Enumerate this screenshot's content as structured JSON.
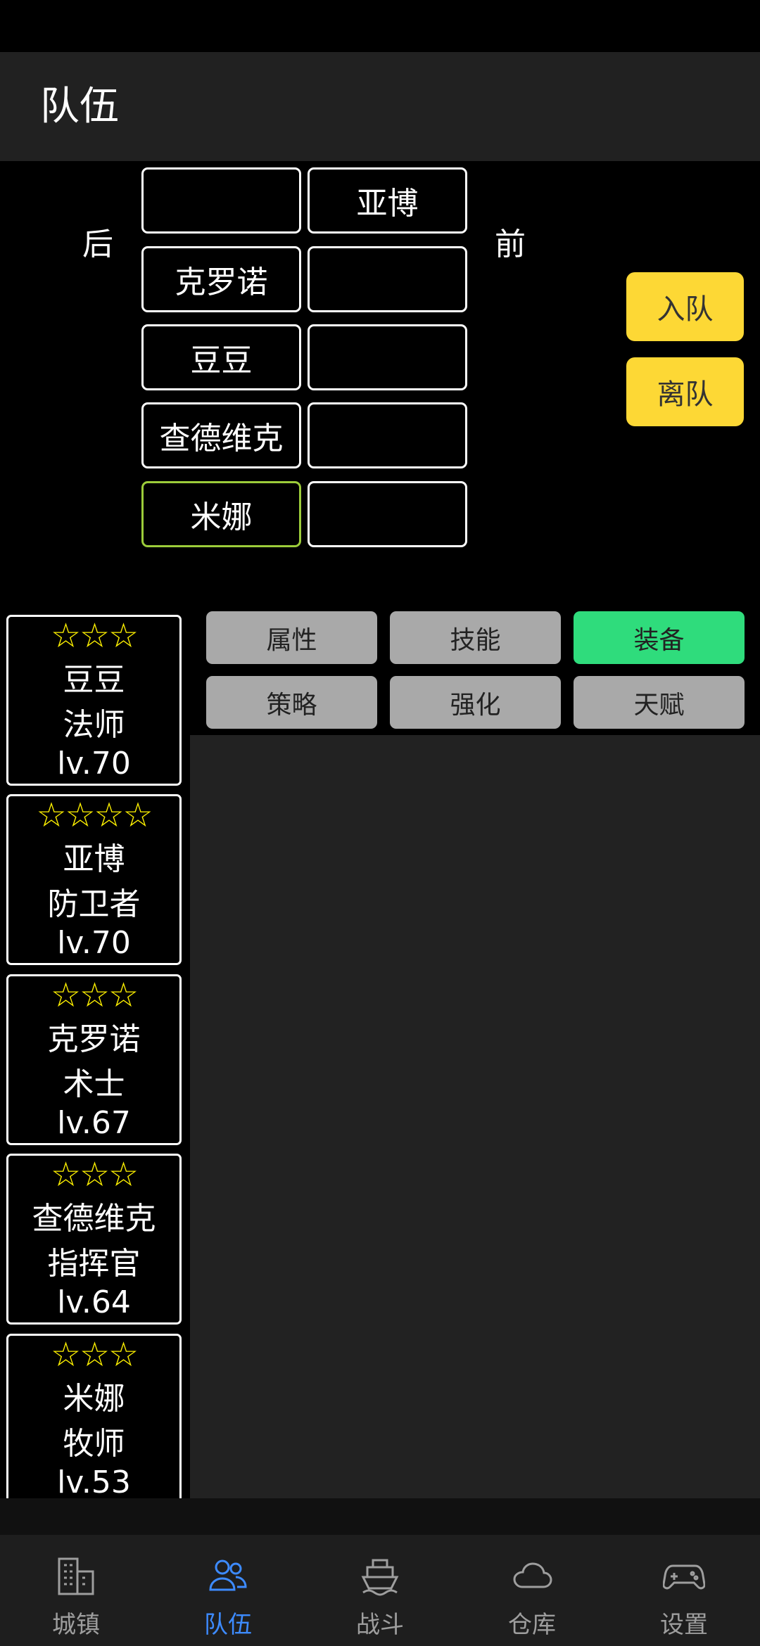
{
  "app": {
    "title": "队伍"
  },
  "formation": {
    "back_label": "后",
    "front_label": "前",
    "rows": [
      {
        "back": "",
        "front": "亚博"
      },
      {
        "back": "克罗诺",
        "front": ""
      },
      {
        "back": "豆豆",
        "front": ""
      },
      {
        "back": "查德维克",
        "front": ""
      },
      {
        "back": "米娜",
        "front": ""
      }
    ],
    "join_button": "入队",
    "leave_button": "离队"
  },
  "roster": [
    {
      "stars": "☆☆☆",
      "name": "豆豆",
      "class": "法师",
      "level": "lv.70"
    },
    {
      "stars": "☆☆☆☆",
      "name": "亚博",
      "class": "防卫者",
      "level": "lv.70"
    },
    {
      "stars": "☆☆☆",
      "name": "克罗诺",
      "class": "术士",
      "level": "lv.67"
    },
    {
      "stars": "☆☆☆",
      "name": "查德维克",
      "class": "指挥官",
      "level": "lv.64"
    },
    {
      "stars": "☆☆☆",
      "name": "米娜",
      "class": "牧师",
      "level": "lv.53"
    }
  ],
  "tabs": [
    {
      "label": "属性"
    },
    {
      "label": "技能"
    },
    {
      "label": "装备",
      "active": true
    },
    {
      "label": "策略"
    },
    {
      "label": "强化"
    },
    {
      "label": "天赋"
    }
  ],
  "nav": [
    {
      "label": "城镇",
      "icon": "building-icon"
    },
    {
      "label": "队伍",
      "icon": "people-icon",
      "active": true
    },
    {
      "label": "战斗",
      "icon": "ship-icon"
    },
    {
      "label": "仓库",
      "icon": "cloud-icon"
    },
    {
      "label": "设置",
      "icon": "gamepad-icon"
    }
  ],
  "colors": {
    "accent_yellow": "#fdd835",
    "active_tab": "#2fdc7c",
    "nav_active": "#3d8bff",
    "star": "#fff200",
    "selected_slot_border": "#9ccc3a"
  }
}
